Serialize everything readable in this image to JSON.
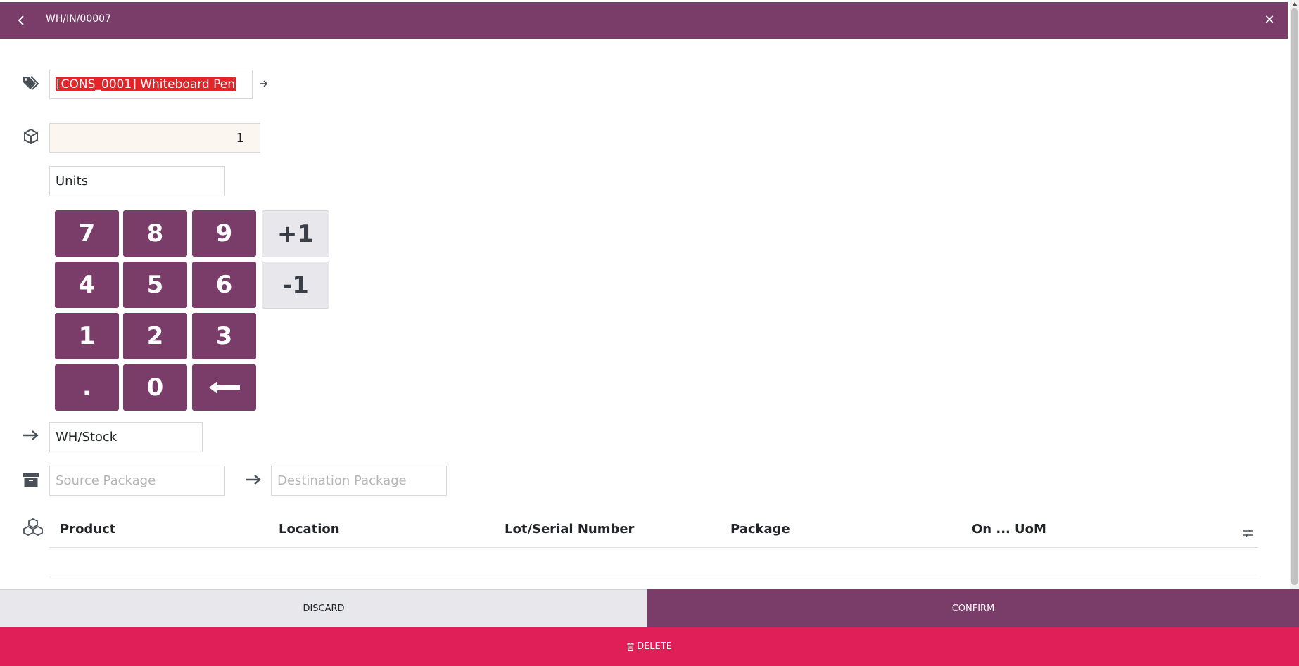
{
  "header": {
    "title": "WH/IN/00007",
    "back_icon": "chevron-left-icon",
    "close_icon": "close-icon"
  },
  "product": {
    "value": "[CONS_0001] Whiteboard Pen",
    "icon": "tags-icon",
    "goto_icon": "arrow-right-icon"
  },
  "quantity": {
    "value": "1",
    "icon": "cube-icon"
  },
  "uom": {
    "value": "Units"
  },
  "keypad": {
    "keys": [
      "7",
      "8",
      "9",
      "4",
      "5",
      "6",
      "1",
      "2",
      "3",
      ".",
      "0"
    ],
    "backspace_icon": "backspace-arrow-icon",
    "plus_one": "+1",
    "minus_one": "-1"
  },
  "location": {
    "icon": "arrow-right-icon",
    "value": "WH/Stock"
  },
  "packages": {
    "icon": "archive-box-icon",
    "source_placeholder": "Source Package",
    "arrow_icon": "arrow-right-icon",
    "destination_placeholder": "Destination Package"
  },
  "table": {
    "icon": "cubes-icon",
    "columns": [
      "Product",
      "Location",
      "Lot/Serial Number",
      "Package",
      "On ...",
      "UoM"
    ],
    "settings_icon": "sliders-icon"
  },
  "footer": {
    "discard_label": "DISCARD",
    "confirm_label": "CONFIRM",
    "delete_label": "DELETE",
    "delete_icon": "trash-icon"
  },
  "colors": {
    "primary": "#7a3d6a",
    "danger": "#e01e57",
    "selection": "#e3252a",
    "secondary_button": "#e8e8ec"
  }
}
